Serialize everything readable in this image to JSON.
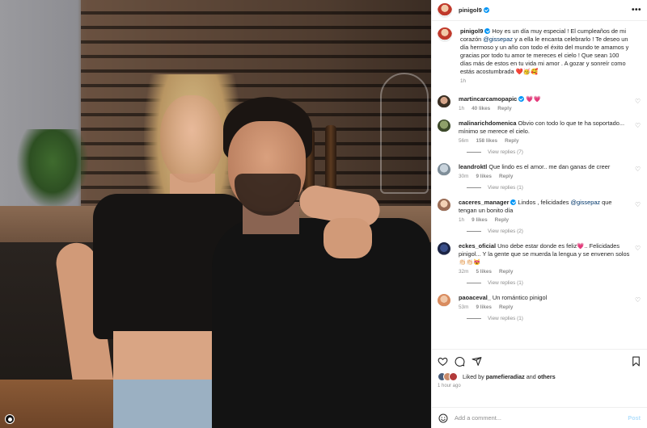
{
  "post": {
    "author": "pinigol9",
    "caption_prefix": "Hoy es un día muy especial ! El cumpleaños de mi corazón ",
    "caption_mention": "@gissepaz",
    "caption_suffix": " y a ella le encanta celebrarlo ! Te deseo un día hermoso y un año con todo el éxito del mundo te amamos y gracias por todo tu amor te mereces el cielo ! Que sean 100 días más de estos en tu vida mi amor . A gozar y sonreír como estás acostumbrada ❤️🥳🥰",
    "caption_time": "1h"
  },
  "comments": [
    {
      "user": "martincarcamopapic",
      "verified": true,
      "text": "💗💗",
      "time": "1h",
      "likes": "40 likes",
      "reply": "Reply",
      "view_replies": ""
    },
    {
      "user": "malinarichdomenica",
      "verified": false,
      "text": "Obvio con todo lo que te ha soportado... mínimo se merece el cielo.",
      "time": "56m",
      "likes": "158 likes",
      "reply": "Reply",
      "view_replies": "View replies (7)"
    },
    {
      "user": "leandroktl",
      "verified": false,
      "text": "Que lindo es el amor.. me dan ganas de creer",
      "time": "30m",
      "likes": "9 likes",
      "reply": "Reply",
      "view_replies": "View replies (1)"
    },
    {
      "user": "caceres_manager",
      "verified": true,
      "text_prefix": "Lindos , felicidades ",
      "mention": "@gissepaz",
      "text_suffix": " que tengan un bonito día",
      "time": "1h",
      "likes": "9 likes",
      "reply": "Reply",
      "view_replies": "View replies (2)"
    },
    {
      "user": "eckes_oficial",
      "verified": false,
      "text": "Uno debe estar donde es feliz💗.. Felicidades pinigol... Y la gente que se muerda la lengua y se envenen solos👏🏻👏🏻😻",
      "time": "32m",
      "likes": "5 likes",
      "reply": "Reply",
      "view_replies": "View replies (1)"
    },
    {
      "user": "paoaceval_",
      "verified": false,
      "text": "Un romántico pinigol",
      "time": "53m",
      "likes": "9 likes",
      "reply": "Reply",
      "view_replies": "View replies (1)"
    }
  ],
  "likes": {
    "prefix": "Liked by ",
    "user": "pamefieradiaz",
    "middle": " and ",
    "others": "others"
  },
  "time_ago": "1 hour ago",
  "add_comment": {
    "placeholder": "Add a comment...",
    "post_label": "Post"
  },
  "colors": {
    "accent": "#0095f6",
    "mention": "#00376b",
    "muted": "#8e8e8e",
    "post_disabled": "#b2dffc"
  }
}
